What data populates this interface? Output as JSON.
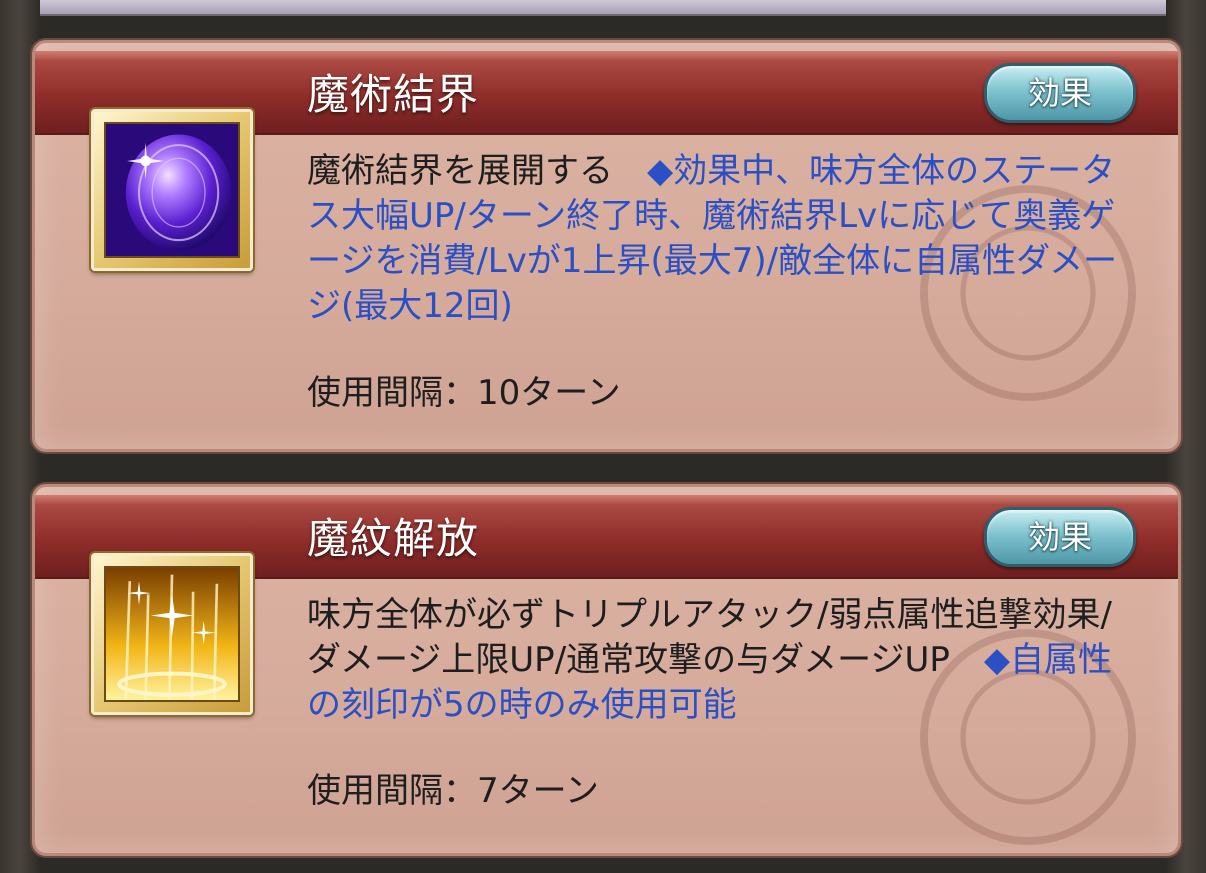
{
  "skills": [
    {
      "title": "魔術結界",
      "effect_label": "効果",
      "icon": "magic-barrier-orb-icon",
      "desc_plain": "魔術結界を展開する　",
      "desc_highlight": "◆効果中、味方全体のステータス大幅UP/ターン終了時、魔術結界Lvに応じて奥義ゲージを消費/Lvが1上昇(最大7)/敵全体に自属性ダメージ(最大12回)",
      "cooldown": "使用間隔：10ターン"
    },
    {
      "title": "魔紋解放",
      "effect_label": "効果",
      "icon": "golden-light-burst-icon",
      "desc_plain": "味方全体が必ずトリプルアタック/弱点属性追撃効果/ダメージ上限UP/通常攻撃の与ダメージUP　",
      "desc_highlight": "◆自属性の刻印が5の時のみ使用可能",
      "cooldown": "使用間隔：7ターン"
    }
  ]
}
